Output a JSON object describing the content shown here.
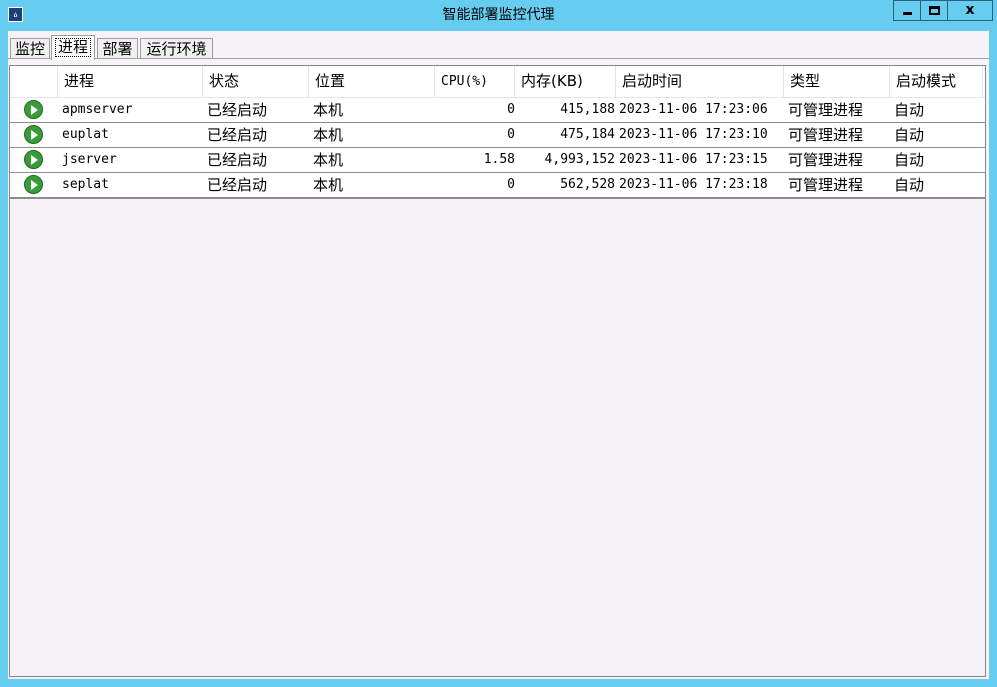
{
  "window": {
    "title": "智能部署监控代理",
    "icon": "app-icon",
    "close_label": "x"
  },
  "tabs": [
    {
      "label": "监控",
      "active": false
    },
    {
      "label": "进程",
      "active": true
    },
    {
      "label": "部署",
      "active": false
    },
    {
      "label": "运行环境",
      "active": false
    }
  ],
  "table": {
    "columns": [
      "",
      "进程",
      "状态",
      "位置",
      "CPU(%)",
      "内存(KB)",
      "启动时间",
      "类型",
      "启动模式"
    ],
    "rows": [
      {
        "icon": "running-icon",
        "process": "apmserver",
        "status": "已经启动",
        "location": "本机",
        "cpu": "0",
        "memory": "415,188",
        "start_time": "2023-11-06 17:23:06",
        "type": "可管理进程",
        "mode": "自动"
      },
      {
        "icon": "running-icon",
        "process": "euplat",
        "status": "已经启动",
        "location": "本机",
        "cpu": "0",
        "memory": "475,184",
        "start_time": "2023-11-06 17:23:10",
        "type": "可管理进程",
        "mode": "自动"
      },
      {
        "icon": "running-icon",
        "process": "jserver",
        "status": "已经启动",
        "location": "本机",
        "cpu": "1.58",
        "memory": "4,993,152",
        "start_time": "2023-11-06 17:23:15",
        "type": "可管理进程",
        "mode": "自动"
      },
      {
        "icon": "running-icon",
        "process": "seplat",
        "status": "已经启动",
        "location": "本机",
        "cpu": "0",
        "memory": "562,528",
        "start_time": "2023-11-06 17:23:18",
        "type": "可管理进程",
        "mode": "自动"
      }
    ]
  },
  "colors": {
    "title_bar": "#66ccf0",
    "client_bg": "#f7f2f7",
    "running_green": "#3a9b3a"
  }
}
